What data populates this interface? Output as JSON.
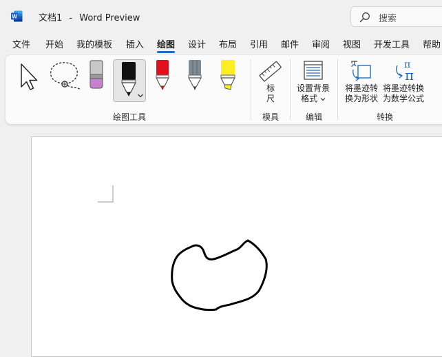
{
  "titlebar": {
    "doc_name": "文档1",
    "separator": "-",
    "app_name": "Word Preview",
    "search_placeholder": "搜索"
  },
  "tabs": [
    {
      "label": "文件"
    },
    {
      "label": "开始"
    },
    {
      "label": "我的模板"
    },
    {
      "label": "插入"
    },
    {
      "label": "绘图",
      "active": true
    },
    {
      "label": "设计"
    },
    {
      "label": "布局"
    },
    {
      "label": "引用"
    },
    {
      "label": "邮件"
    },
    {
      "label": "审阅"
    },
    {
      "label": "视图"
    },
    {
      "label": "开发工具"
    },
    {
      "label": "帮助"
    }
  ],
  "ribbon": {
    "groups": {
      "drawing_tools": "绘图工具",
      "stencils": "模具",
      "edit": "编辑",
      "convert": "转换"
    },
    "ruler": {
      "line1": "标",
      "line2": "尺"
    },
    "background": {
      "line1": "设置背景",
      "line2": "格式"
    },
    "ink_to_shape": {
      "line1": "将墨迹转",
      "line2": "换为形状"
    },
    "ink_to_math": {
      "line1": "将墨迹转换",
      "line2": "为数学公式"
    },
    "pen_colors": {
      "eraser": "#c77fd0",
      "black_pen": "#111111",
      "red_pen": "#e0101f",
      "gray_pencil": "#7f8a93",
      "highlighter": "#ffee22"
    },
    "accent": "#1e6bc8"
  }
}
